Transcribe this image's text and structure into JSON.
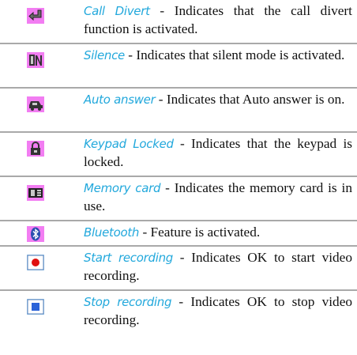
{
  "rows": [
    {
      "icon": "call-divert-icon",
      "term": "Call Divert",
      "desc": " - Indicates that the call divert function is activated."
    },
    {
      "icon": "silence-icon",
      "term": "Silence",
      "desc": " - Indicates that silent mode is activated."
    },
    {
      "icon": "auto-answer-icon",
      "term": "Auto answer",
      "desc": " - Indicates that Auto answer is on."
    },
    {
      "icon": "keypad-locked-icon",
      "term": "Keypad Locked",
      "desc": " - Indicates that the keypad is locked."
    },
    {
      "icon": "memory-card-icon",
      "term": "Memory card",
      "desc": " - Indicates the memory card is in use."
    },
    {
      "icon": "bluetooth-icon",
      "term": "Bluetooth",
      "desc": " - Feature is activated."
    },
    {
      "icon": "start-recording-icon",
      "term": "Start recording",
      "desc": " - Indicates OK to start video recording."
    },
    {
      "icon": "stop-recording-icon",
      "term": "Stop recording",
      "desc": " - Indicates OK to stop video recording."
    }
  ],
  "colors": {
    "term": "#22a8dc",
    "icon_bg": "#f27df2",
    "icon_blue_bg": "#9fd0f5",
    "divider": "#a9a9a9"
  }
}
